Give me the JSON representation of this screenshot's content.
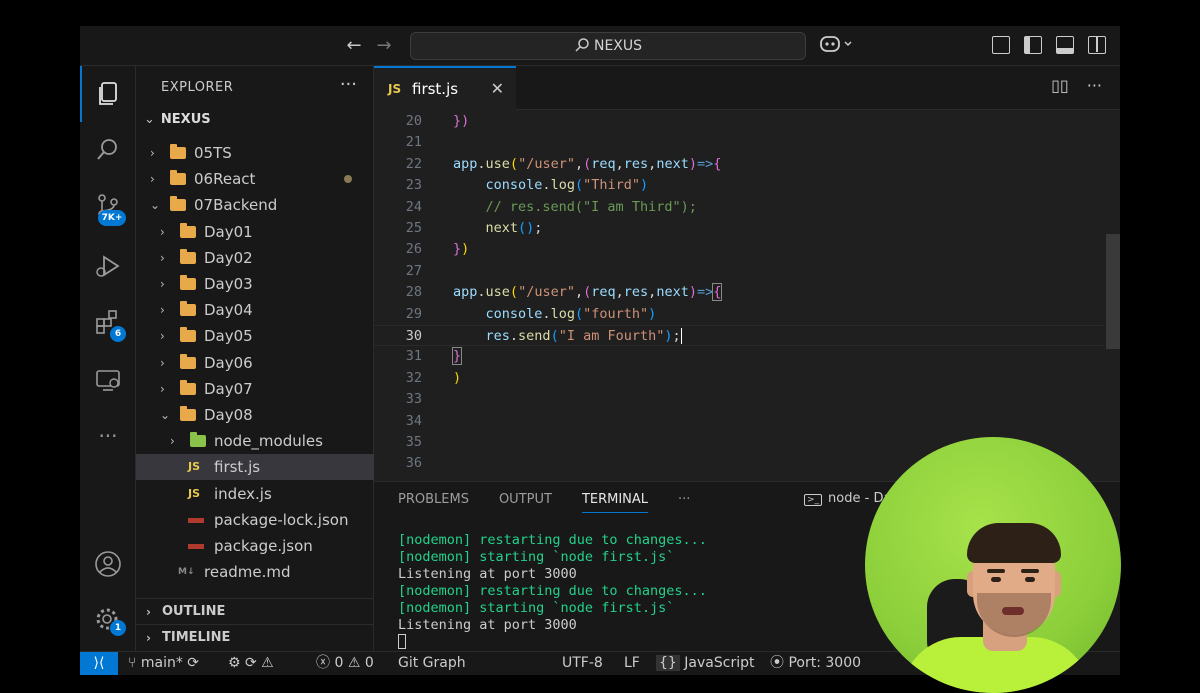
{
  "window": {
    "search_text": "NEXUS",
    "layout_icons": [
      "layout-customize-icon",
      "toggle-primary-sidebar-icon",
      "toggle-panel-icon",
      "toggle-secondary-sidebar-icon"
    ]
  },
  "activity_bar": {
    "source_control_badge": "7K+",
    "extensions_badge": "6",
    "settings_badge": "1",
    "accent_color": "#0078d4"
  },
  "explorer": {
    "title": "EXPLORER",
    "root": "NEXUS",
    "items": [
      {
        "label": "05TS",
        "type": "folder",
        "expanded": false
      },
      {
        "label": "06React",
        "type": "folder",
        "expanded": false,
        "modified": true
      },
      {
        "label": "07Backend",
        "type": "folder",
        "expanded": true
      },
      {
        "label": "Day01",
        "type": "folder",
        "expanded": false
      },
      {
        "label": "Day02",
        "type": "folder",
        "expanded": false
      },
      {
        "label": "Day03",
        "type": "folder",
        "expanded": false
      },
      {
        "label": "Day04",
        "type": "folder",
        "expanded": false
      },
      {
        "label": "Day05",
        "type": "folder",
        "expanded": false
      },
      {
        "label": "Day06",
        "type": "folder",
        "expanded": false
      },
      {
        "label": "Day07",
        "type": "folder",
        "expanded": false
      },
      {
        "label": "Day08",
        "type": "folder",
        "expanded": true
      },
      {
        "label": "node_modules",
        "type": "folder",
        "expanded": false
      },
      {
        "label": "first.js",
        "type": "js",
        "selected": true
      },
      {
        "label": "index.js",
        "type": "js"
      },
      {
        "label": "package-lock.json",
        "type": "json"
      },
      {
        "label": "package.json",
        "type": "json"
      },
      {
        "label": "readme.md",
        "type": "md"
      }
    ],
    "file_badges": {
      "js": "JS",
      "md": "M↓"
    },
    "outline": "OUTLINE",
    "timeline": "TIMELINE"
  },
  "editor": {
    "active_tab": "first.js",
    "tab_badge": "JS",
    "current_line": 30,
    "lines": [
      {
        "n": 20,
        "html": "<span style=\"color:#da70d6\">})</span>"
      },
      {
        "n": 21,
        "html": ""
      },
      {
        "n": 22,
        "html": "<span style=\"color:#9cdcfe\">app</span>.<span style=\"color:#dcdcaa\">use</span><span style=\"color:#ffd700\">(</span><span style=\"color:#ce9178\">\"/user\"</span>,<span style=\"color:#da70d6\">(</span><span style=\"color:#9cdcfe\">req</span>,<span style=\"color:#9cdcfe\">res</span>,<span style=\"color:#9cdcfe\">next</span><span style=\"color:#da70d6\">)</span><span style=\"color:#569cd6\">=></span><span style=\"color:#da70d6\">{</span>"
      },
      {
        "n": 23,
        "html": "    <span style=\"color:#9cdcfe\">console</span>.<span style=\"color:#dcdcaa\">log</span><span style=\"color:#179fff\">(</span><span style=\"color:#ce9178\">\"Third\"</span><span style=\"color:#179fff\">)</span>"
      },
      {
        "n": 24,
        "html": "    <span style=\"color:#6a9955\">// res.send(\"I am Third\");</span>"
      },
      {
        "n": 25,
        "html": "    <span style=\"color:#dcdcaa\">next</span><span style=\"color:#179fff\">()</span>;"
      },
      {
        "n": 26,
        "html": "<span style=\"color:#da70d6\">}</span><span style=\"color:#ffd700\">)</span>"
      },
      {
        "n": 27,
        "html": ""
      },
      {
        "n": 28,
        "html": "<span style=\"color:#9cdcfe\">app</span>.<span style=\"color:#dcdcaa\">use</span><span style=\"color:#ffd700\">(</span><span style=\"color:#ce9178\">\"/user\"</span>,<span style=\"color:#da70d6\">(</span><span style=\"color:#9cdcfe\">req</span>,<span style=\"color:#9cdcfe\">res</span>,<span style=\"color:#9cdcfe\">next</span><span style=\"color:#da70d6\">)</span><span style=\"color:#569cd6\">=></span><span style=\"color:#da70d6;outline:1px solid #888\">{</span>"
      },
      {
        "n": 29,
        "html": "    <span style=\"color:#9cdcfe\">console</span>.<span style=\"color:#dcdcaa\">log</span><span style=\"color:#179fff\">(</span><span style=\"color:#ce9178\">\"fourth\"</span><span style=\"color:#179fff\">)</span>"
      },
      {
        "n": 30,
        "html": "    <span style=\"color:#9cdcfe\">res</span>.<span style=\"color:#dcdcaa\">send</span><span style=\"color:#179fff\">(</span><span style=\"color:#ce9178\">\"I am Fourth\"</span><span style=\"color:#179fff\">)</span>;<span style=\"border-left:1.5px solid #fff\"></span>"
      },
      {
        "n": 31,
        "html": "<span style=\"color:#da70d6;outline:1px solid #888\">}</span>"
      },
      {
        "n": 32,
        "html": "<span style=\"color:#ffd700\">)</span>"
      },
      {
        "n": 33,
        "html": ""
      },
      {
        "n": 34,
        "html": ""
      },
      {
        "n": 35,
        "html": ""
      },
      {
        "n": 36,
        "html": ""
      }
    ]
  },
  "panel": {
    "tabs": [
      "PROBLEMS",
      "OUTPUT",
      "TERMINAL"
    ],
    "active_tab": "TERMINAL",
    "more": "···",
    "terminal_title": "node - Da",
    "terminal_lines": [
      {
        "tag": "[nodemon]",
        "text": " restarting due to changes...",
        "green": true
      },
      {
        "tag": "[nodemon]",
        "text": " starting `node first.js`",
        "green": true
      },
      {
        "tag": "",
        "text": "Listening at port 3000",
        "green": false
      },
      {
        "tag": "[nodemon]",
        "text": " restarting due to changes...",
        "green": true
      },
      {
        "tag": "[nodemon]",
        "text": " starting `node first.js`",
        "green": true
      },
      {
        "tag": "",
        "text": "Listening at port 3000",
        "green": false
      }
    ]
  },
  "status_bar": {
    "branch": "main*",
    "errors": "0",
    "warnings": "0",
    "git_graph": "Git Graph",
    "encoding": "UTF-8",
    "eol": "LF",
    "language": "JavaScript",
    "port": "Port: 3000"
  }
}
